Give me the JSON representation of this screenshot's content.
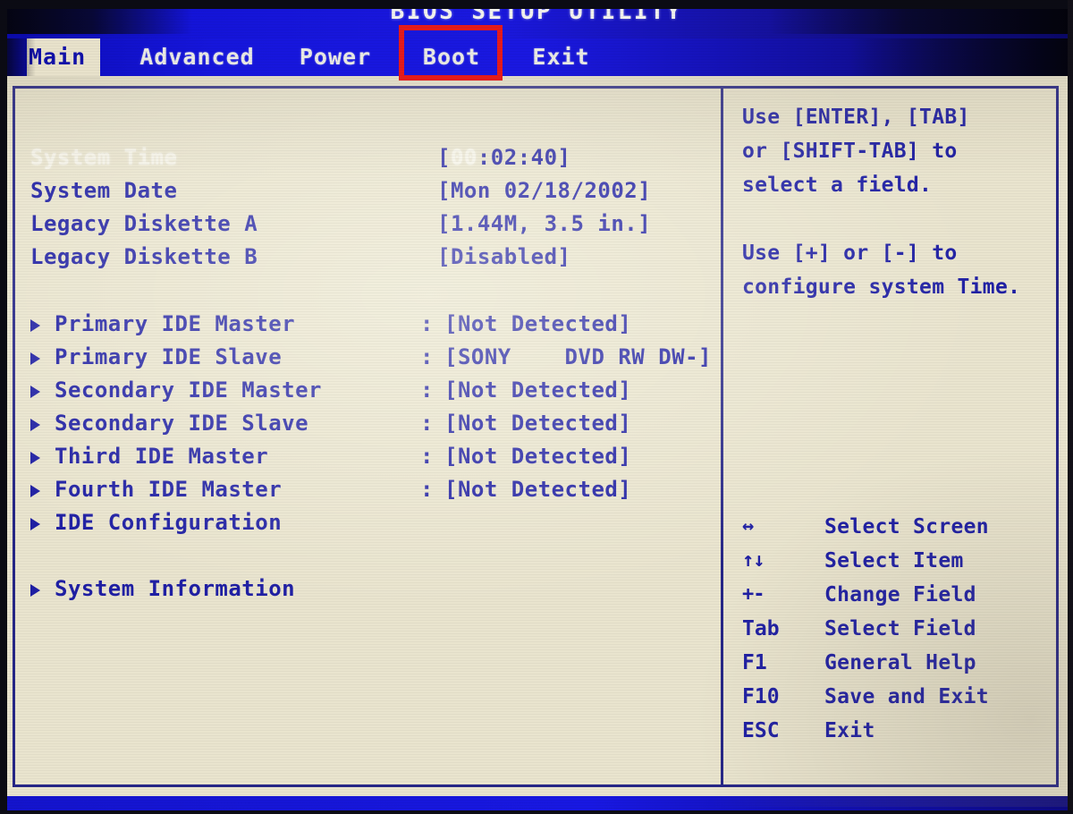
{
  "title_bar": {
    "title": "BIOS SETUP UTILITY"
  },
  "menu": {
    "items": [
      {
        "label": "Main",
        "active": true
      },
      {
        "label": "Advanced",
        "active": false
      },
      {
        "label": "Power",
        "active": false
      },
      {
        "label": "Boot",
        "active": false
      },
      {
        "label": "Exit",
        "active": false
      }
    ]
  },
  "annotation": {
    "target": "Boot",
    "color": "#e51b1b"
  },
  "main_panel": {
    "settings": [
      {
        "label": "System Time",
        "value_highlight": "00",
        "value_rest": ":02:40]",
        "value_prefix": "[",
        "selected": true
      },
      {
        "label": "System Date",
        "value": "[Mon 02/18/2002]",
        "selected": false
      },
      {
        "label": "Legacy Diskette A",
        "value": "[1.44M, 3.5 in.]",
        "selected": false
      },
      {
        "label": "Legacy Diskette B",
        "value": "[Disabled]",
        "selected": false
      }
    ],
    "submenus": [
      {
        "label": "Primary IDE Master",
        "colon": ":",
        "value": "[Not Detected]"
      },
      {
        "label": "Primary IDE Slave",
        "colon": ":",
        "value": "[SONY    DVD RW DW-]"
      },
      {
        "label": "Secondary IDE Master",
        "colon": ":",
        "value": "[Not Detected]"
      },
      {
        "label": "Secondary IDE Slave",
        "colon": ":",
        "value": "[Not Detected]"
      },
      {
        "label": "Third IDE Master",
        "colon": ":",
        "value": "[Not Detected]"
      },
      {
        "label": "Fourth IDE Master",
        "colon": ":",
        "value": "[Not Detected]"
      },
      {
        "label": "IDE Configuration",
        "colon": "",
        "value": ""
      },
      {
        "label": "System Information",
        "colon": "",
        "value": "",
        "spacer_before": true
      }
    ]
  },
  "help_panel": {
    "lines": [
      "Use [ENTER], [TAB]",
      "or [SHIFT-TAB] to",
      "select a field.",
      "",
      "Use [+] or [-] to",
      "configure system Time."
    ],
    "keys": [
      {
        "key": "↔",
        "desc": "Select Screen",
        "glyph": true
      },
      {
        "key": "↑↓",
        "desc": "Select Item",
        "glyph": true
      },
      {
        "key": "+-",
        "desc": "Change Field",
        "glyph": true
      },
      {
        "key": "Tab",
        "desc": "Select Field",
        "glyph": false
      },
      {
        "key": "F1",
        "desc": "General Help",
        "glyph": false
      },
      {
        "key": "F10",
        "desc": "Save and Exit",
        "glyph": false
      },
      {
        "key": "ESC",
        "desc": "Exit",
        "glyph": false
      }
    ]
  },
  "colors": {
    "screen_blue": "#1a18de",
    "text_blue": "#1f1fa4",
    "panel_cream": "#e9e4ce",
    "highlight_white": "#f6f4ea",
    "annotation_red": "#e51b1b"
  }
}
